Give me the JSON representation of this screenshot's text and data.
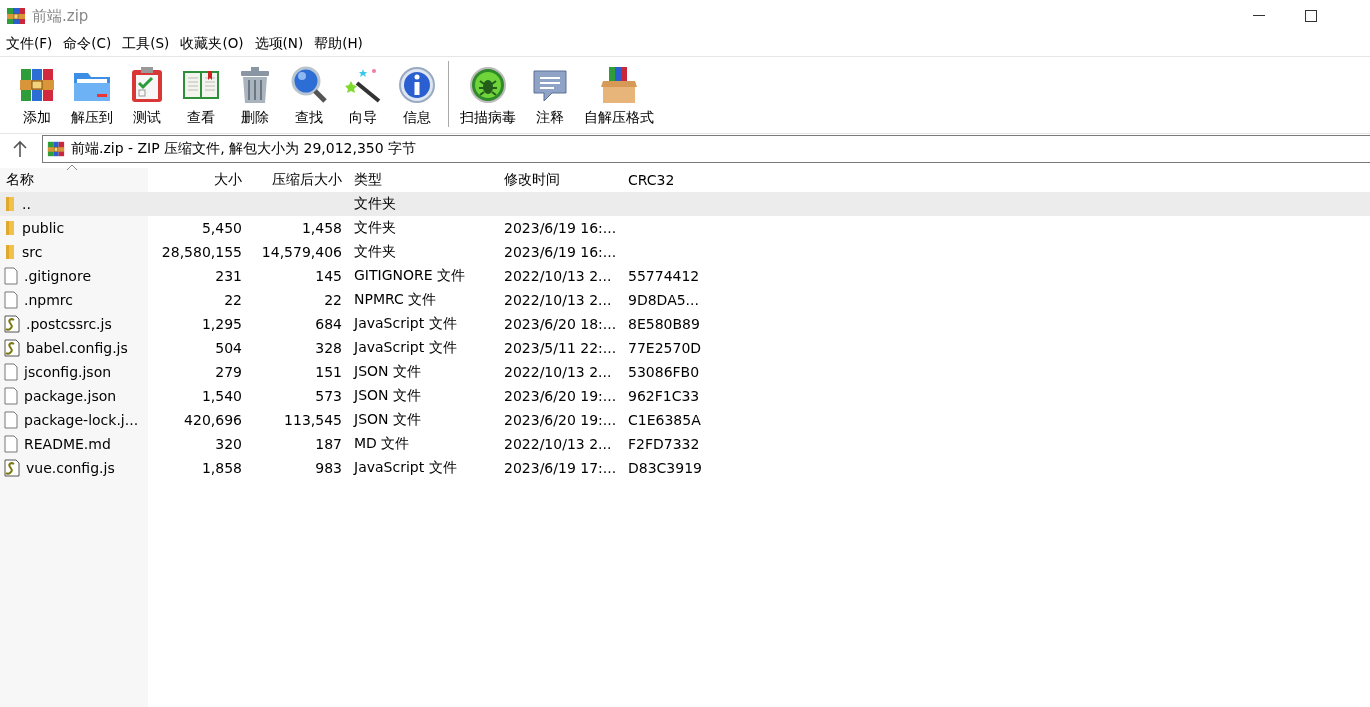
{
  "window": {
    "title": "前端.zip"
  },
  "menu": [
    "文件(F)",
    "命令(C)",
    "工具(S)",
    "收藏夹(O)",
    "选项(N)",
    "帮助(H)"
  ],
  "toolbar": [
    {
      "label": "添加",
      "kind": "books"
    },
    {
      "label": "解压到",
      "kind": "folder"
    },
    {
      "label": "测试",
      "kind": "clipboard"
    },
    {
      "label": "查看",
      "kind": "book"
    },
    {
      "label": "删除",
      "kind": "trash"
    },
    {
      "label": "查找",
      "kind": "magnifier"
    },
    {
      "label": "向导",
      "kind": "wand"
    },
    {
      "label": "信息",
      "kind": "info"
    },
    {
      "label": "扫描病毒",
      "kind": "bug"
    },
    {
      "label": "注释",
      "kind": "comment"
    },
    {
      "label": "自解压格式",
      "kind": "box"
    }
  ],
  "address": {
    "text": "前端.zip - ZIP 压缩文件, 解包大小为 29,012,350 字节"
  },
  "table": {
    "columns": [
      "名称",
      "大小",
      "压缩后大小",
      "类型",
      "修改时间",
      "CRC32"
    ],
    "rows": [
      {
        "kind": "up",
        "selected": true,
        "cells": [
          "..",
          "",
          "",
          "文件夹",
          "",
          ""
        ]
      },
      {
        "kind": "folder",
        "selected": false,
        "cells": [
          "public",
          "5,450",
          "1,458",
          "文件夹",
          "2023/6/19 16:...",
          ""
        ]
      },
      {
        "kind": "folder",
        "selected": false,
        "cells": [
          "src",
          "28,580,155",
          "14,579,406",
          "文件夹",
          "2023/6/19 16:...",
          ""
        ]
      },
      {
        "kind": "file",
        "selected": false,
        "cells": [
          ".gitignore",
          "231",
          "145",
          "GITIGNORE 文件",
          "2022/10/13 2...",
          "55774412"
        ]
      },
      {
        "kind": "file",
        "selected": false,
        "cells": [
          ".npmrc",
          "22",
          "22",
          "NPMRC 文件",
          "2022/10/13 2...",
          "9D8DA5..."
        ]
      },
      {
        "kind": "script",
        "selected": false,
        "cells": [
          ".postcssrc.js",
          "1,295",
          "684",
          "JavaScript 文件",
          "2023/6/20 18:...",
          "8E580B89"
        ]
      },
      {
        "kind": "script",
        "selected": false,
        "cells": [
          "babel.config.js",
          "504",
          "328",
          "JavaScript 文件",
          "2023/5/11 22:...",
          "77E2570D"
        ]
      },
      {
        "kind": "file",
        "selected": false,
        "cells": [
          "jsconfig.json",
          "279",
          "151",
          "JSON 文件",
          "2022/10/13 2...",
          "53086FB0"
        ]
      },
      {
        "kind": "file",
        "selected": false,
        "cells": [
          "package.json",
          "1,540",
          "573",
          "JSON 文件",
          "2023/6/20 19:...",
          "962F1C33"
        ]
      },
      {
        "kind": "file",
        "selected": false,
        "cells": [
          "package-lock.j...",
          "420,696",
          "113,545",
          "JSON 文件",
          "2023/6/20 19:...",
          "C1E6385A"
        ]
      },
      {
        "kind": "file",
        "selected": false,
        "cells": [
          "README.md",
          "320",
          "187",
          "MD 文件",
          "2022/10/13 2...",
          "F2FD7332"
        ]
      },
      {
        "kind": "script",
        "selected": false,
        "cells": [
          "vue.config.js",
          "1,858",
          "983",
          "JavaScript 文件",
          "2023/6/19 17:...",
          "D83C3919"
        ]
      }
    ]
  }
}
